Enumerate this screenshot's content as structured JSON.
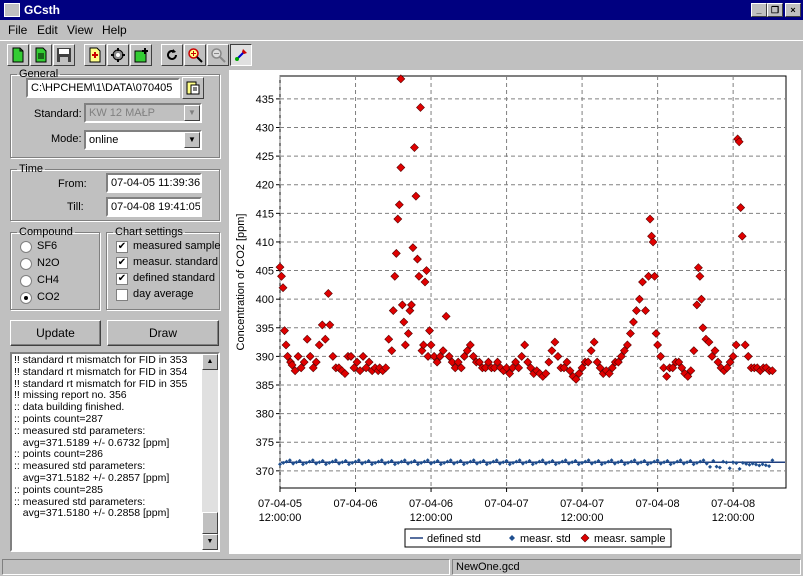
{
  "window": {
    "title": "GCsth"
  },
  "menu": [
    "File",
    "Edit",
    "View",
    "Help"
  ],
  "toolbar_icons": [
    "new-icon",
    "open-icon",
    "save-icon",
    "export-icon",
    "settings-icon",
    "add-icon",
    "refresh-icon",
    "zoom-in-icon",
    "zoom-out-icon",
    "paint-icon"
  ],
  "general": {
    "legend": "General",
    "path": "C:\\HPCHEM\\1\\DATA\\070405",
    "standard_label": "Standard:",
    "standard_value": "KW 12 MAŁP",
    "mode_label": "Mode:",
    "mode_value": "online"
  },
  "time": {
    "legend": "Time",
    "from_label": "From:",
    "from_value": "07-04-05 11:39:36",
    "till_label": "Till:",
    "till_value": "07-04-08 19:41:05"
  },
  "compound": {
    "legend": "Compound",
    "options": [
      "SF6",
      "N2O",
      "CH4",
      "CO2"
    ],
    "selected": "CO2"
  },
  "chart_settings": {
    "legend": "Chart settings",
    "options": [
      {
        "label": "measured sample",
        "checked": true
      },
      {
        "label": "measur. standard",
        "checked": true
      },
      {
        "label": "defined standard",
        "checked": true
      },
      {
        "label": "day average",
        "checked": false
      }
    ]
  },
  "buttons": {
    "update": "Update",
    "draw": "Draw"
  },
  "log": [
    "!! standard rt mismatch for FID in 353",
    "!! standard rt mismatch for FID in 354",
    "!! standard rt mismatch for FID in 355",
    "!! missing report no. 356",
    ":: data building finished.",
    ":: points count=287",
    ":: measured std parameters:",
    "   avg=371.5189 +/- 0.6732 [ppm]",
    ":: points count=286",
    ":: measured std parameters:",
    "   avg=371.5182 +/- 0.2857 [ppm]",
    ":: points count=285",
    ":: measured std parameters:",
    "   avg=371.5180 +/- 0.2858 [ppm]"
  ],
  "status": {
    "left": "",
    "file": "NewOne.gcd"
  },
  "colors": {
    "titlebar": "#000080",
    "sample": "#e00000",
    "std": "#1f4f8f",
    "defined": "#1f3f7f"
  },
  "chart_data": {
    "type": "scatter",
    "ylabel": "Concentration of CO2 [ppm]",
    "xlabel": "",
    "ylim": [
      367,
      439
    ],
    "yticks": [
      370,
      375,
      380,
      385,
      390,
      395,
      400,
      405,
      410,
      415,
      420,
      425,
      430,
      435
    ],
    "xlim": [
      0,
      3.35
    ],
    "xticks": [
      {
        "x": 0,
        "line1": "07-04-05",
        "line2": "12:00:00"
      },
      {
        "x": 0.5,
        "line1": "07-04-06",
        "line2": ""
      },
      {
        "x": 1.0,
        "line1": "07-04-06",
        "line2": "12:00:00"
      },
      {
        "x": 1.5,
        "line1": "07-04-07",
        "line2": ""
      },
      {
        "x": 2.0,
        "line1": "07-04-07",
        "line2": "12:00:00"
      },
      {
        "x": 2.5,
        "line1": "07-04-08",
        "line2": ""
      },
      {
        "x": 3.0,
        "line1": "07-04-08",
        "line2": "12:00:00"
      }
    ],
    "grid": true,
    "legend": [
      "defined std",
      "measr. std",
      "measr. sample"
    ],
    "defined_std": 371.5,
    "measured_std_avg": 371.5,
    "sample": [
      [
        0.0,
        405.6
      ],
      [
        0.01,
        404
      ],
      [
        0.02,
        402
      ],
      [
        0.03,
        394.5
      ],
      [
        0.04,
        392
      ],
      [
        0.05,
        390
      ],
      [
        0.07,
        389
      ],
      [
        0.08,
        388.5
      ],
      [
        0.1,
        387.5
      ],
      [
        0.12,
        390
      ],
      [
        0.14,
        388
      ],
      [
        0.16,
        389
      ],
      [
        0.18,
        393
      ],
      [
        0.2,
        390
      ],
      [
        0.22,
        388
      ],
      [
        0.24,
        389
      ],
      [
        0.26,
        392
      ],
      [
        0.28,
        395.5
      ],
      [
        0.3,
        393
      ],
      [
        0.32,
        401
      ],
      [
        0.33,
        395.5
      ],
      [
        0.35,
        390
      ],
      [
        0.37,
        388
      ],
      [
        0.39,
        388
      ],
      [
        0.41,
        387.5
      ],
      [
        0.43,
        387
      ],
      [
        0.45,
        390
      ],
      [
        0.47,
        390
      ],
      [
        0.49,
        388
      ],
      [
        0.51,
        389
      ],
      [
        0.53,
        387.5
      ],
      [
        0.55,
        390
      ],
      [
        0.57,
        388
      ],
      [
        0.59,
        389
      ],
      [
        0.61,
        387.5
      ],
      [
        0.63,
        388
      ],
      [
        0.65,
        387.5
      ],
      [
        0.66,
        388
      ],
      [
        0.68,
        387.5
      ],
      [
        0.7,
        388
      ],
      [
        0.72,
        393
      ],
      [
        0.74,
        391
      ],
      [
        0.75,
        398
      ],
      [
        0.76,
        404
      ],
      [
        0.77,
        408
      ],
      [
        0.78,
        414
      ],
      [
        0.79,
        416.5
      ],
      [
        0.8,
        423
      ],
      [
        0.81,
        399
      ],
      [
        0.82,
        396
      ],
      [
        0.83,
        392
      ],
      [
        0.85,
        394
      ],
      [
        0.86,
        398
      ],
      [
        0.87,
        399
      ],
      [
        0.88,
        409
      ],
      [
        0.89,
        426.5
      ],
      [
        0.9,
        418
      ],
      [
        0.91,
        407
      ],
      [
        0.92,
        404
      ],
      [
        0.8,
        438.5
      ],
      [
        0.93,
        433.5
      ],
      [
        0.94,
        391
      ],
      [
        0.95,
        392
      ],
      [
        0.96,
        403
      ],
      [
        0.97,
        405
      ],
      [
        0.98,
        390
      ],
      [
        0.99,
        394.5
      ],
      [
        1.0,
        392
      ],
      [
        1.02,
        390
      ],
      [
        1.04,
        389
      ],
      [
        1.06,
        390
      ],
      [
        1.08,
        391
      ],
      [
        1.1,
        397
      ],
      [
        1.12,
        390
      ],
      [
        1.14,
        389
      ],
      [
        1.16,
        388
      ],
      [
        1.18,
        389
      ],
      [
        1.2,
        388
      ],
      [
        1.22,
        390
      ],
      [
        1.24,
        391
      ],
      [
        1.26,
        392
      ],
      [
        1.28,
        390
      ],
      [
        1.3,
        389
      ],
      [
        1.32,
        389
      ],
      [
        1.34,
        388
      ],
      [
        1.36,
        388
      ],
      [
        1.38,
        389
      ],
      [
        1.4,
        388
      ],
      [
        1.42,
        388
      ],
      [
        1.44,
        389
      ],
      [
        1.46,
        388
      ],
      [
        1.48,
        387.5
      ],
      [
        1.5,
        388
      ],
      [
        1.52,
        387
      ],
      [
        1.54,
        388
      ],
      [
        1.56,
        389
      ],
      [
        1.58,
        388
      ],
      [
        1.6,
        390
      ],
      [
        1.62,
        392
      ],
      [
        1.64,
        389
      ],
      [
        1.66,
        388
      ],
      [
        1.68,
        387
      ],
      [
        1.7,
        387.5
      ],
      [
        1.72,
        387
      ],
      [
        1.74,
        386.5
      ],
      [
        1.76,
        387
      ],
      [
        1.78,
        389
      ],
      [
        1.8,
        391
      ],
      [
        1.82,
        392.5
      ],
      [
        1.84,
        390
      ],
      [
        1.86,
        388
      ],
      [
        1.88,
        388
      ],
      [
        1.9,
        389
      ],
      [
        1.92,
        387.5
      ],
      [
        1.94,
        386.5
      ],
      [
        1.96,
        386
      ],
      [
        1.98,
        387
      ],
      [
        2.0,
        388
      ],
      [
        2.02,
        389
      ],
      [
        2.04,
        389
      ],
      [
        2.06,
        391
      ],
      [
        2.08,
        392.5
      ],
      [
        2.1,
        389
      ],
      [
        2.12,
        388
      ],
      [
        2.14,
        387
      ],
      [
        2.16,
        387.5
      ],
      [
        2.18,
        387
      ],
      [
        2.2,
        388
      ],
      [
        2.22,
        389
      ],
      [
        2.24,
        389
      ],
      [
        2.26,
        390
      ],
      [
        2.28,
        391
      ],
      [
        2.3,
        392
      ],
      [
        2.32,
        394
      ],
      [
        2.34,
        396
      ],
      [
        2.36,
        398
      ],
      [
        2.38,
        400
      ],
      [
        2.4,
        403
      ],
      [
        2.42,
        398
      ],
      [
        2.44,
        404
      ],
      [
        2.45,
        414
      ],
      [
        2.46,
        411
      ],
      [
        2.47,
        410
      ],
      [
        2.48,
        404
      ],
      [
        2.49,
        394
      ],
      [
        2.5,
        392
      ],
      [
        2.52,
        390
      ],
      [
        2.54,
        388
      ],
      [
        2.56,
        386.5
      ],
      [
        2.58,
        388
      ],
      [
        2.6,
        388
      ],
      [
        2.62,
        389
      ],
      [
        2.64,
        389
      ],
      [
        2.66,
        388
      ],
      [
        2.68,
        387
      ],
      [
        2.7,
        386.5
      ],
      [
        2.72,
        387.5
      ],
      [
        2.74,
        391
      ],
      [
        2.76,
        399
      ],
      [
        2.77,
        405.5
      ],
      [
        2.78,
        404
      ],
      [
        2.79,
        400
      ],
      [
        2.8,
        395
      ],
      [
        2.82,
        393
      ],
      [
        2.84,
        392.5
      ],
      [
        2.86,
        390
      ],
      [
        2.88,
        391
      ],
      [
        2.9,
        389
      ],
      [
        2.92,
        388
      ],
      [
        2.94,
        387.5
      ],
      [
        2.96,
        388
      ],
      [
        2.98,
        389
      ],
      [
        3.0,
        390
      ],
      [
        3.02,
        392
      ],
      [
        3.03,
        428
      ],
      [
        3.04,
        427.5
      ],
      [
        3.05,
        416
      ],
      [
        3.06,
        411
      ],
      [
        3.08,
        392
      ],
      [
        3.1,
        390
      ],
      [
        3.12,
        388
      ],
      [
        3.14,
        388
      ],
      [
        3.16,
        388
      ],
      [
        3.18,
        387.5
      ],
      [
        3.2,
        388
      ],
      [
        3.22,
        388
      ],
      [
        3.24,
        387.5
      ],
      [
        3.26,
        387.5
      ]
    ]
  }
}
